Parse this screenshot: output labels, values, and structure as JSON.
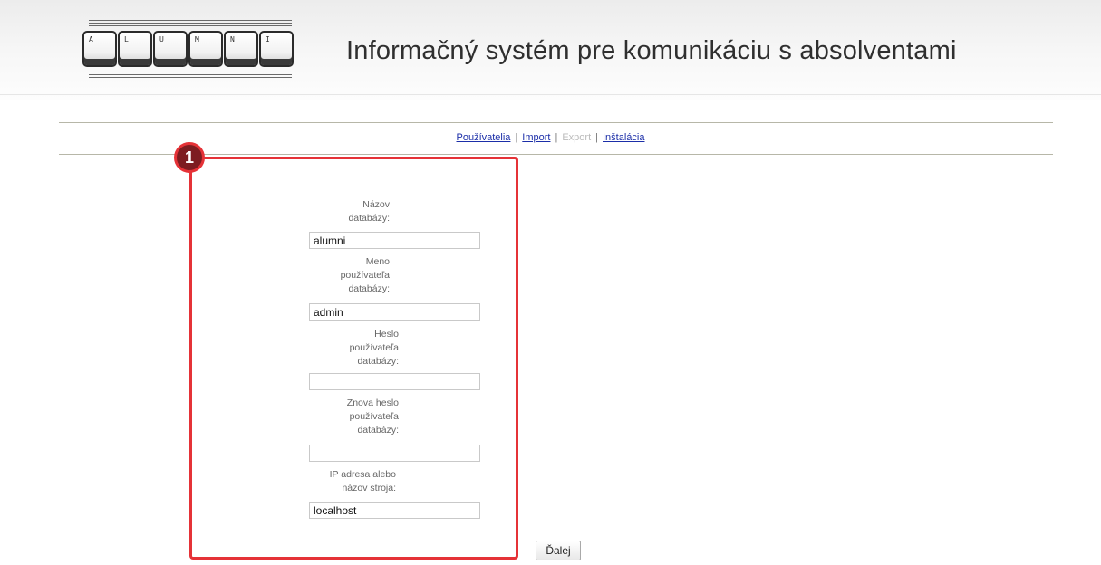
{
  "header": {
    "logo_letters": [
      "A",
      "L",
      "U",
      "M",
      "N",
      "I"
    ],
    "title": "Informačný systém pre komunikáciu s absolventami"
  },
  "nav": {
    "items": [
      {
        "label": "Používatelia",
        "enabled": true
      },
      {
        "label": "Import",
        "enabled": true
      },
      {
        "label": "Export",
        "enabled": false
      },
      {
        "label": "Inštalácia",
        "enabled": true
      }
    ],
    "separator": "|"
  },
  "annotation": {
    "marker_number": "1",
    "highlight_color": "#e53237"
  },
  "form": {
    "fields": [
      {
        "label": [
          "Názov",
          "databázy:"
        ],
        "value": "alumni",
        "type": "text"
      },
      {
        "label": [
          "Meno",
          "používateľa",
          "databázy:"
        ],
        "value": "admin",
        "type": "text"
      },
      {
        "label": [
          "Heslo",
          "používateľa",
          "databázy:"
        ],
        "value": "",
        "type": "password"
      },
      {
        "label": [
          "Znova heslo",
          "používateľa",
          "databázy:"
        ],
        "value": "",
        "type": "password"
      },
      {
        "label": [
          "IP adresa alebo",
          "názov stroja:"
        ],
        "value": "localhost",
        "type": "text"
      }
    ],
    "submit_label": "Ďalej"
  }
}
